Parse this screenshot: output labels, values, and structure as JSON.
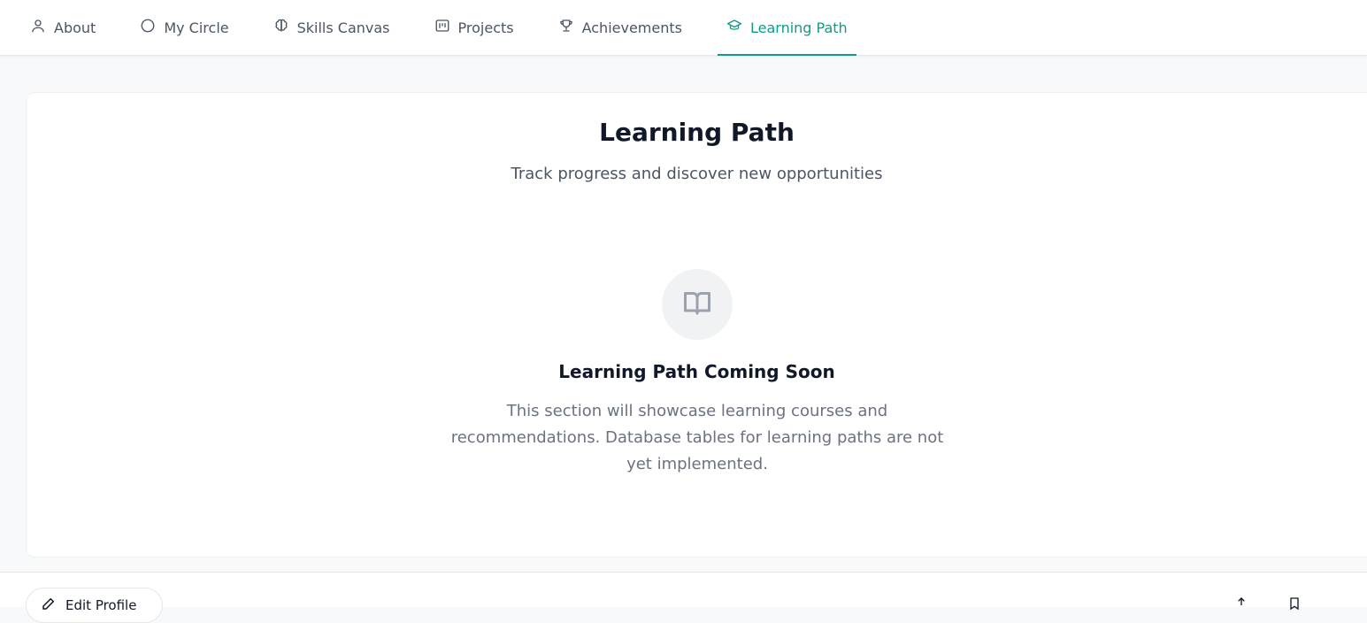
{
  "nav": {
    "tabs": [
      {
        "label": "About",
        "icon": "user-icon"
      },
      {
        "label": "My Circle",
        "icon": "circle-icon"
      },
      {
        "label": "Skills Canvas",
        "icon": "brain-icon"
      },
      {
        "label": "Projects",
        "icon": "kanban-icon"
      },
      {
        "label": "Achievements",
        "icon": "trophy-icon"
      },
      {
        "label": "Learning Path",
        "icon": "graduation-cap-icon",
        "active": true
      }
    ]
  },
  "section": {
    "title": "Learning Path",
    "subtitle": "Track progress and discover new opportunities"
  },
  "empty_state": {
    "icon": "book-open-icon",
    "title": "Learning Path Coming Soon",
    "description": "This section will showcase learning courses and recommendations. Database tables for learning paths are not yet implemented."
  },
  "footer": {
    "edit_button_label": "Edit Profile"
  },
  "colors": {
    "accent": "#159a87",
    "background": "#f8f9fa",
    "card": "#ffffff"
  }
}
